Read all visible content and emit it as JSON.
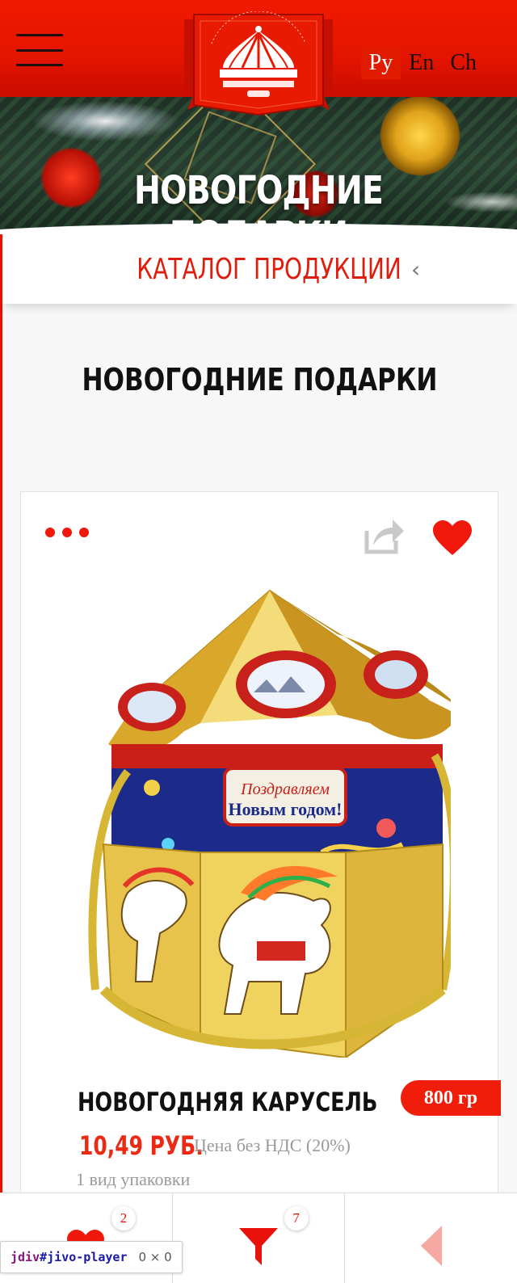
{
  "header": {
    "logo_alt": "Красный Октябрь",
    "languages": [
      {
        "label": "Ру",
        "active": true
      },
      {
        "label": "En",
        "active": false
      },
      {
        "label": "Ch",
        "active": false
      }
    ]
  },
  "banner": {
    "title": "НОВОГОДНИЕ ПОДАРКИ"
  },
  "breadcrumb": {
    "label": "КАТАЛОГ ПРОДУКЦИИ",
    "chevron": "‹"
  },
  "main": {
    "page_title": "НОВОГОДНИЕ ПОДАРКИ"
  },
  "product": {
    "name": "НОВОГОДНЯЯ КАРУСЕЛЬ",
    "weight": "800 гр",
    "price": "10,49 РУБ.",
    "price_note": "Цена без НДС (20%)",
    "pack_type": "1 вид упаковки",
    "image_caption": "Поздравляем С Новым годом!"
  },
  "bottom_bar": {
    "favorites_count": "2",
    "filter_count": "7"
  },
  "debug": {
    "selector_tag": "jdiv",
    "selector_id": "#jivo-player",
    "size": "0 × 0"
  },
  "colors": {
    "brand_red": "#e31400",
    "accent_red": "#f0180a",
    "price_red": "#ec2a14"
  }
}
